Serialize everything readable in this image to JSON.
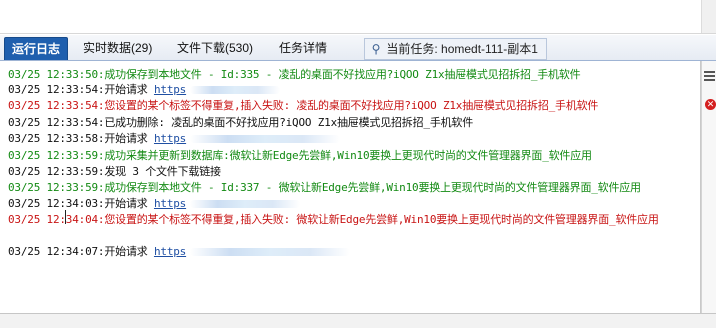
{
  "tabs": [
    {
      "label": "运行日志",
      "active": true
    },
    {
      "label": "实时数据(29)",
      "active": false
    },
    {
      "label": "文件下载(530)",
      "active": false
    },
    {
      "label": "任务详情",
      "active": false
    }
  ],
  "current_task": {
    "label": "当前任务:",
    "value": "homedt-111-副本1"
  },
  "log": [
    {
      "time": "03/25 12:33:50",
      "text": ":成功保存到本地文件 - Id:335 - 凌乱的桌面不好找应用?iQOO Z1x抽屉模式见招拆招_手机软件",
      "color": "green"
    },
    {
      "time": "03/25 12:33:54",
      "text": ":开始请求 ",
      "link": "https",
      "color": "black"
    },
    {
      "time": "03/25 12:33:54",
      "text": ":您设置的某个标签不得重复,插入失败: 凌乱的桌面不好找应用?iQOO Z1x抽屉模式见招拆招_手机软件",
      "color": "red"
    },
    {
      "time": "03/25 12:33:54",
      "text": ":已成功删除: 凌乱的桌面不好找应用?iQOO Z1x抽屉模式见招拆招_手机软件",
      "color": "black"
    },
    {
      "time": "03/25 12:33:58",
      "text": ":开始请求 ",
      "link": "https",
      "color": "black"
    },
    {
      "time": "03/25 12:33:59",
      "text": ":成功采集并更新到数据库:微软让新Edge先尝鲜,Win10要换上更现代时尚的文件管理器界面_软件应用",
      "color": "green"
    },
    {
      "time": "03/25 12:33:59",
      "text": ":发现 3 个文件下载链接",
      "color": "black"
    },
    {
      "time": "03/25 12:33:59",
      "text": ":成功保存到本地文件 - Id:337 - 微软让新Edge先尝鲜,Win10要换上更现代时尚的文件管理器界面_软件应用",
      "color": "green"
    },
    {
      "time": "03/25 12:34:03",
      "text": ":开始请求 ",
      "link": "https",
      "color": "black"
    },
    {
      "time": "03/25 12:34:04",
      "text": ":您设置的某个标签不得重复,插入失败: 微软让新Edge先尝鲜,Win10要换上更现代时尚的文件管理器界面_软件应用",
      "color": "red"
    },
    {
      "time": "03/25 12:34:07",
      "text": ":开始请求 ",
      "link": "https",
      "color": "black"
    }
  ],
  "icons": {
    "menu": "hamburger-menu-icon",
    "error": "error-x-icon",
    "location": "location-pin-icon"
  },
  "colors": {
    "success": "#138a13",
    "error": "#c81414",
    "normal": "#111111",
    "link": "#1f4fa3",
    "active_tab": "#1f5fae"
  }
}
